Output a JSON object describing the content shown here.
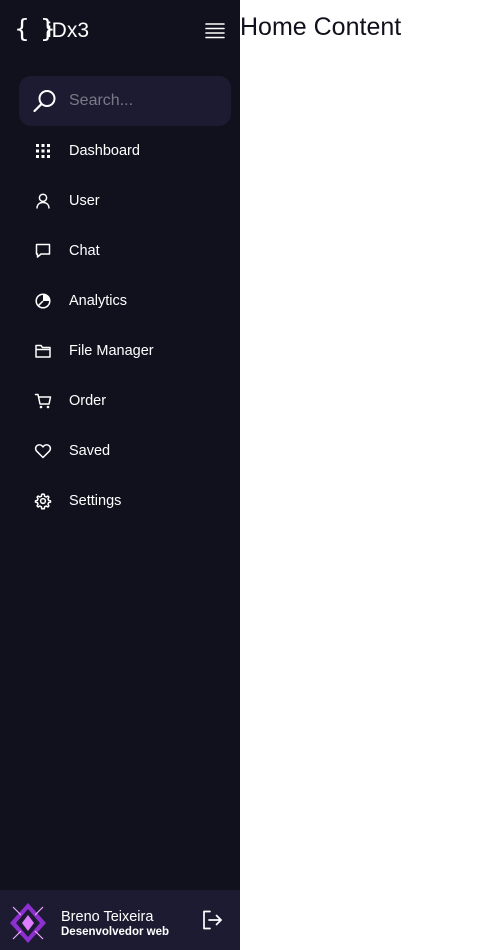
{
  "logo": {
    "icon": "{ }",
    "name": "iDx3"
  },
  "header": {
    "menu_icon": "hamburger-icon"
  },
  "search": {
    "placeholder": "Search...",
    "value": "",
    "icon": "search-icon"
  },
  "sidebar": {
    "items": [
      {
        "label": "Dashboard",
        "icon": "grid-icon"
      },
      {
        "label": "User",
        "icon": "user-icon"
      },
      {
        "label": "Chat",
        "icon": "chat-icon"
      },
      {
        "label": "Analytics",
        "icon": "pie-chart-icon"
      },
      {
        "label": "File Manager",
        "icon": "folder-icon"
      },
      {
        "label": "Order",
        "icon": "cart-icon"
      },
      {
        "label": "Saved",
        "icon": "heart-icon"
      },
      {
        "label": "Settings",
        "icon": "cog-icon"
      }
    ]
  },
  "profile": {
    "name": "Breno Teixeira",
    "job": "Desenvolvedor web",
    "logout_icon": "log-out-icon"
  },
  "main": {
    "title": "Home Content"
  },
  "colors": {
    "sidebar_bg": "#11101d",
    "panel_bg": "#1d1b31",
    "avatar_accent": "#c24cf6",
    "text": "#ffffff"
  }
}
